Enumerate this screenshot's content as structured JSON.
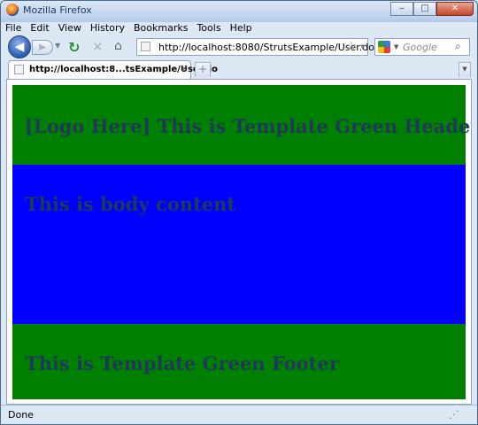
{
  "window": {
    "title": "Mozilla Firefox",
    "controls": {
      "minimize": "‒",
      "maximize": "□",
      "close": "✕"
    }
  },
  "menubar": {
    "items": [
      {
        "label": "File"
      },
      {
        "label": "Edit"
      },
      {
        "label": "View"
      },
      {
        "label": "History"
      },
      {
        "label": "Bookmarks"
      },
      {
        "label": "Tools"
      },
      {
        "label": "Help"
      }
    ]
  },
  "navbar": {
    "url": "http://localhost:8080/StrutsExample/User.do",
    "search_placeholder": "Google",
    "icons": {
      "back": "back-arrow-icon",
      "forward": "forward-arrow-icon",
      "reload": "reload-icon",
      "stop": "stop-icon",
      "home": "home-icon",
      "bookmark": "star-icon",
      "search_engine": "google-icon",
      "search_go": "magnifier-icon"
    }
  },
  "tabs": {
    "active": {
      "title": "http://localhost:8...tsExample/User.do"
    }
  },
  "page": {
    "header_text": "[Logo Here] This is Template Green Header",
    "body_text": "This is body content",
    "footer_text": "This is Template Green Footer",
    "colors": {
      "header": "#008000",
      "body": "#0000ff",
      "footer": "#008000"
    }
  },
  "statusbar": {
    "text": "Done"
  }
}
